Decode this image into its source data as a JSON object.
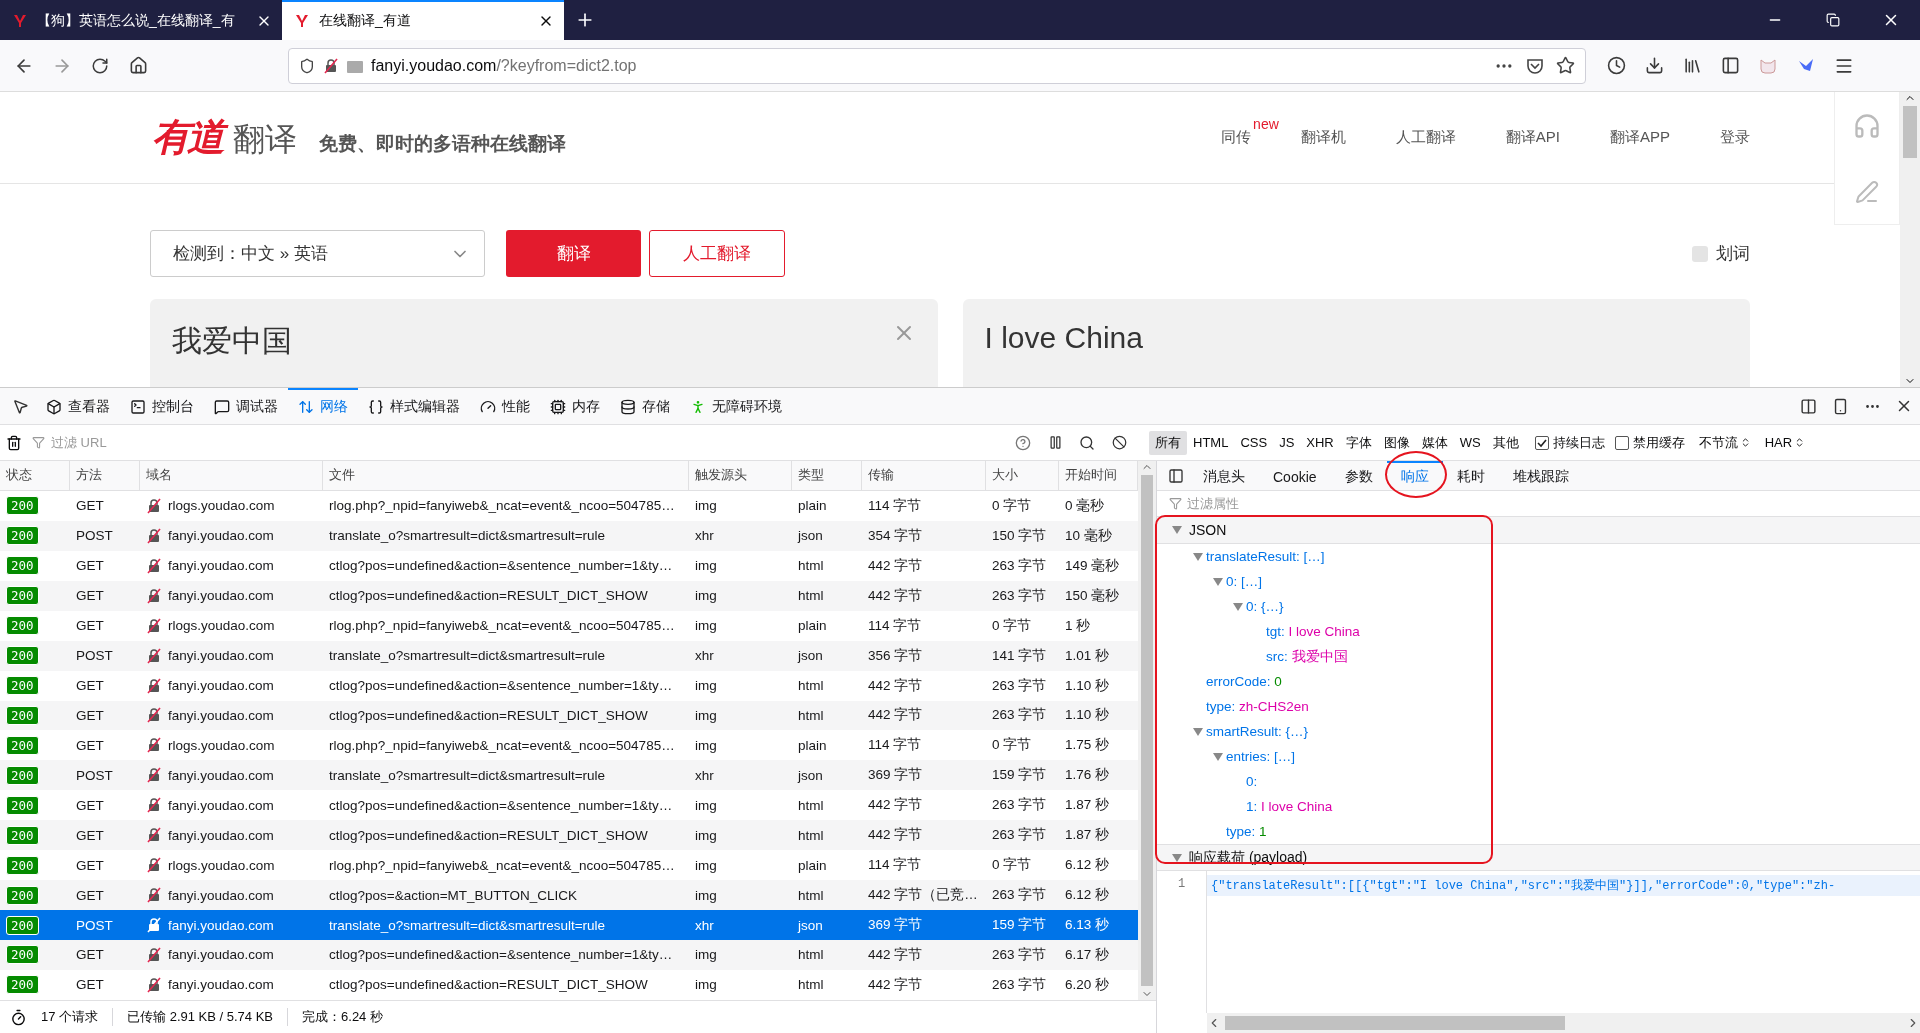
{
  "browser": {
    "tabs": [
      {
        "title": "【狗】英语怎么说_在线翻译_有",
        "selected": false
      },
      {
        "title": "在线翻译_有道",
        "selected": true
      }
    ],
    "url": {
      "host": "fanyi.youdao.com",
      "path": "/?keyfrom=dict2.top"
    }
  },
  "site": {
    "logo": {
      "mark": "有道",
      "name": "翻译"
    },
    "slogan": "免费、即时的多语种在线翻译",
    "nav": [
      {
        "label": "同传",
        "badge": "new"
      },
      {
        "label": "翻译机"
      },
      {
        "label": "人工翻译"
      },
      {
        "label": "翻译API"
      },
      {
        "label": "翻译APP"
      },
      {
        "label": "登录"
      }
    ],
    "language": "检测到：中文 » 英语",
    "translate_button": "翻译",
    "human_button": "人工翻译",
    "word_select": {
      "label": "划词",
      "checked": false
    },
    "source_text": "我爱中国",
    "result_text": "I love China"
  },
  "devtools": {
    "tabs": [
      {
        "label": "查看器",
        "selected": false
      },
      {
        "label": "控制台",
        "selected": false
      },
      {
        "label": "调试器",
        "selected": false
      },
      {
        "label": "网络",
        "selected": true
      },
      {
        "label": "样式编辑器",
        "selected": false
      },
      {
        "label": "性能",
        "selected": false
      },
      {
        "label": "内存",
        "selected": false
      },
      {
        "label": "存储",
        "selected": false
      },
      {
        "label": "无障碍环境",
        "selected": false
      }
    ],
    "filter_placeholder": "过滤 URL",
    "type_filters": [
      {
        "label": "所有",
        "selected": true
      },
      {
        "label": "HTML",
        "selected": false
      },
      {
        "label": "CSS",
        "selected": false
      },
      {
        "label": "JS",
        "selected": false
      },
      {
        "label": "XHR",
        "selected": false
      },
      {
        "label": "字体",
        "selected": false
      },
      {
        "label": "图像",
        "selected": false
      },
      {
        "label": "媒体",
        "selected": false
      },
      {
        "label": "WS",
        "selected": false
      },
      {
        "label": "其他",
        "selected": false
      }
    ],
    "options": [
      {
        "label": "持续日志",
        "checked": true
      },
      {
        "label": "禁用缓存",
        "checked": false
      }
    ],
    "throttle": "不节流",
    "har": "HAR",
    "requests": {
      "columns": [
        "状态",
        "方法",
        "域名",
        "文件",
        "触发源头",
        "类型",
        "传输",
        "大小",
        "开始时间"
      ],
      "rows": [
        {
          "status": "200",
          "method": "GET",
          "domain": "rlogs.youdao.com",
          "file": "rlog.php?_npid=fanyiweb&_ncat=event&_ncoo=504785…",
          "cause": "img",
          "type": "plain",
          "transferred": "114 字节",
          "size": "0 字节",
          "start": "0 毫秒",
          "selected": false
        },
        {
          "status": "200",
          "method": "POST",
          "domain": "fanyi.youdao.com",
          "file": "translate_o?smartresult=dict&smartresult=rule",
          "cause": "xhr",
          "type": "json",
          "transferred": "354 字节",
          "size": "150 字节",
          "start": "10 毫秒",
          "selected": false
        },
        {
          "status": "200",
          "method": "GET",
          "domain": "fanyi.youdao.com",
          "file": "ctlog?pos=undefined&action=&sentence_number=1&ty…",
          "cause": "img",
          "type": "html",
          "transferred": "442 字节",
          "size": "263 字节",
          "start": "149 毫秒",
          "selected": false
        },
        {
          "status": "200",
          "method": "GET",
          "domain": "fanyi.youdao.com",
          "file": "ctlog?pos=undefined&action=RESULT_DICT_SHOW",
          "cause": "img",
          "type": "html",
          "transferred": "442 字节",
          "size": "263 字节",
          "start": "150 毫秒",
          "selected": false
        },
        {
          "status": "200",
          "method": "GET",
          "domain": "rlogs.youdao.com",
          "file": "rlog.php?_npid=fanyiweb&_ncat=event&_ncoo=504785…",
          "cause": "img",
          "type": "plain",
          "transferred": "114 字节",
          "size": "0 字节",
          "start": "1 秒",
          "selected": false
        },
        {
          "status": "200",
          "method": "POST",
          "domain": "fanyi.youdao.com",
          "file": "translate_o?smartresult=dict&smartresult=rule",
          "cause": "xhr",
          "type": "json",
          "transferred": "356 字节",
          "size": "141 字节",
          "start": "1.01 秒",
          "selected": false
        },
        {
          "status": "200",
          "method": "GET",
          "domain": "fanyi.youdao.com",
          "file": "ctlog?pos=undefined&action=&sentence_number=1&ty…",
          "cause": "img",
          "type": "html",
          "transferred": "442 字节",
          "size": "263 字节",
          "start": "1.10 秒",
          "selected": false
        },
        {
          "status": "200",
          "method": "GET",
          "domain": "fanyi.youdao.com",
          "file": "ctlog?pos=undefined&action=RESULT_DICT_SHOW",
          "cause": "img",
          "type": "html",
          "transferred": "442 字节",
          "size": "263 字节",
          "start": "1.10 秒",
          "selected": false
        },
        {
          "status": "200",
          "method": "GET",
          "domain": "rlogs.youdao.com",
          "file": "rlog.php?_npid=fanyiweb&_ncat=event&_ncoo=504785…",
          "cause": "img",
          "type": "plain",
          "transferred": "114 字节",
          "size": "0 字节",
          "start": "1.75 秒",
          "selected": false
        },
        {
          "status": "200",
          "method": "POST",
          "domain": "fanyi.youdao.com",
          "file": "translate_o?smartresult=dict&smartresult=rule",
          "cause": "xhr",
          "type": "json",
          "transferred": "369 字节",
          "size": "159 字节",
          "start": "1.76 秒",
          "selected": false
        },
        {
          "status": "200",
          "method": "GET",
          "domain": "fanyi.youdao.com",
          "file": "ctlog?pos=undefined&action=&sentence_number=1&ty…",
          "cause": "img",
          "type": "html",
          "transferred": "442 字节",
          "size": "263 字节",
          "start": "1.87 秒",
          "selected": false
        },
        {
          "status": "200",
          "method": "GET",
          "domain": "fanyi.youdao.com",
          "file": "ctlog?pos=undefined&action=RESULT_DICT_SHOW",
          "cause": "img",
          "type": "html",
          "transferred": "442 字节",
          "size": "263 字节",
          "start": "1.87 秒",
          "selected": false
        },
        {
          "status": "200",
          "method": "GET",
          "domain": "rlogs.youdao.com",
          "file": "rlog.php?_npid=fanyiweb&_ncat=event&_ncoo=504785…",
          "cause": "img",
          "type": "plain",
          "transferred": "114 字节",
          "size": "0 字节",
          "start": "6.12 秒",
          "selected": false
        },
        {
          "status": "200",
          "method": "GET",
          "domain": "fanyi.youdao.com",
          "file": "ctlog?pos=&action=MT_BUTTON_CLICK",
          "cause": "img",
          "type": "html",
          "transferred": "442 字节（已竞…",
          "size": "263 字节",
          "start": "6.12 秒",
          "selected": false
        },
        {
          "status": "200",
          "method": "POST",
          "domain": "fanyi.youdao.com",
          "file": "translate_o?smartresult=dict&smartresult=rule",
          "cause": "xhr",
          "type": "json",
          "transferred": "369 字节",
          "size": "159 字节",
          "start": "6.13 秒",
          "selected": true
        },
        {
          "status": "200",
          "method": "GET",
          "domain": "fanyi.youdao.com",
          "file": "ctlog?pos=undefined&action=&sentence_number=1&ty…",
          "cause": "img",
          "type": "html",
          "transferred": "442 字节",
          "size": "263 字节",
          "start": "6.17 秒",
          "selected": false
        },
        {
          "status": "200",
          "method": "GET",
          "domain": "fanyi.youdao.com",
          "file": "ctlog?pos=undefined&action=RESULT_DICT_SHOW",
          "cause": "img",
          "type": "html",
          "transferred": "442 字节",
          "size": "263 字节",
          "start": "6.20 秒",
          "selected": false
        }
      ]
    },
    "summary": [
      "17 个请求",
      "已传输 2.91 KB / 5.74 KB",
      "完成：6.24 秒"
    ],
    "details": {
      "tabs": [
        {
          "label": "消息头",
          "selected": false,
          "circled": false
        },
        {
          "label": "Cookie",
          "selected": false,
          "circled": false
        },
        {
          "label": "参数",
          "selected": false,
          "circled": false
        },
        {
          "label": "响应",
          "selected": true,
          "circled": true
        },
        {
          "label": "耗时",
          "selected": false,
          "circled": false
        },
        {
          "label": "堆栈跟踪",
          "selected": false,
          "circled": false
        }
      ],
      "filter_placeholder": "过滤属性",
      "json": {
        "title": "JSON",
        "expanded": true,
        "boxed": true,
        "tree": [
          {
            "key": "translateResult:",
            "value": "[…]",
            "kind": "summary",
            "expanded": true,
            "children": [
              {
                "key": "0:",
                "value": "[…]",
                "kind": "summary",
                "expanded": true,
                "children": [
                  {
                    "key": "0:",
                    "value": "{…}",
                    "kind": "summary",
                    "expanded": true,
                    "children": [
                      {
                        "key": "tgt:",
                        "value": "I love China",
                        "kind": "string"
                      },
                      {
                        "key": "src:",
                        "value": "我爱中国",
                        "kind": "string"
                      }
                    ]
                  }
                ]
              }
            ]
          },
          {
            "key": "errorCode:",
            "value": "0",
            "kind": "number"
          },
          {
            "key": "type:",
            "value": "zh-CHS2en",
            "kind": "string"
          },
          {
            "key": "smartResult:",
            "value": "{…}",
            "kind": "summary",
            "expanded": true,
            "children": [
              {
                "key": "entries:",
                "value": "[…]",
                "kind": "summary",
                "expanded": true,
                "children": [
                  {
                    "key": "0:"
                  },
                  {
                    "key": "1:",
                    "value": "I love China",
                    "kind": "string"
                  }
                ]
              },
              {
                "key": "type:",
                "value": "1",
                "kind": "number"
              }
            ]
          }
        ]
      },
      "payload": {
        "title": "响应载荷 (payload)",
        "expanded": true,
        "lines": [
          {
            "number": "1",
            "code": "{\"translateResult\":[[{\"tgt\":\"I love China\",\"src\":\"我爱中国\"}]],\"errorCode\":0,\"type\":\"zh-"
          }
        ]
      }
    }
  }
}
